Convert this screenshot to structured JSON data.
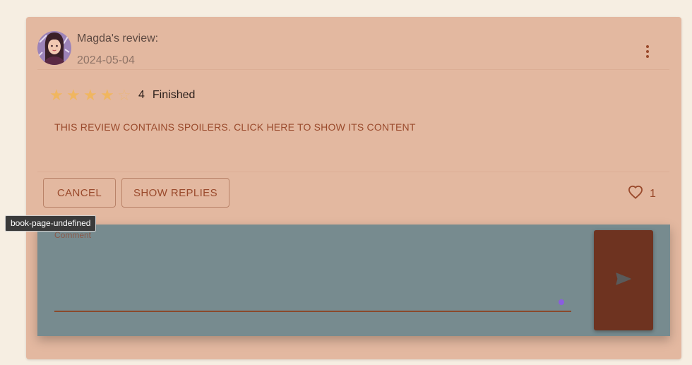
{
  "review": {
    "author": "Magda's review:",
    "date": "2024-05-04",
    "rating": {
      "value": 4,
      "max": 5,
      "label": "4",
      "stars": [
        "filled",
        "filled",
        "filled",
        "filled",
        "empty"
      ]
    },
    "status": "Finished",
    "spoiler_text": "THIS REVIEW CONTAINS SPOILERS. CLICK HERE TO SHOW ITS CONTENT"
  },
  "actions": {
    "cancel_label": "CANCEL",
    "show_replies_label": "SHOW REPLIES",
    "likes_count": "1"
  },
  "comment": {
    "label": "Comment",
    "value": ""
  },
  "tooltip": {
    "text": "book-page-undefined"
  },
  "icons": {
    "menu": "more-vert-icon",
    "like": "heart-outline-icon",
    "send": "send-icon"
  },
  "colors": {
    "card_background": "#e3b8a0",
    "accent": "#9a4a2c",
    "star": "#f0b660",
    "comment_background": "#778b8f",
    "send_button": "#6e3320",
    "page_background": "#f6eee2"
  }
}
